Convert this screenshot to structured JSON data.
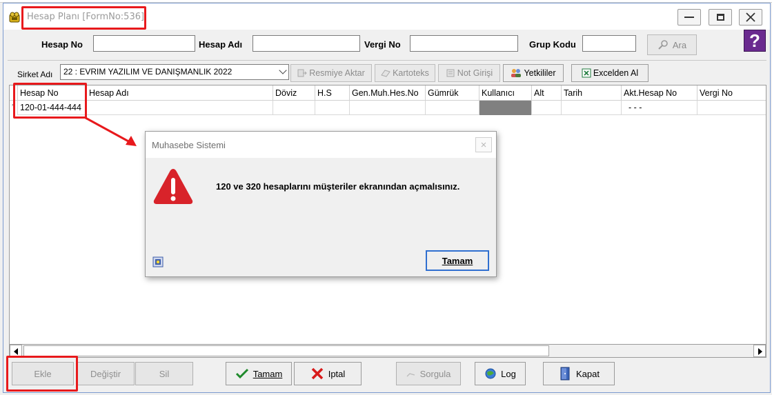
{
  "window": {
    "title": "Hesap Planı [FormNo:536]"
  },
  "search": {
    "hesap_no_label": "Hesap No",
    "hesap_no_value": "",
    "hesap_adi_label": "Hesap Adı",
    "hesap_adi_value": "",
    "vergi_no_label": "Vergi No",
    "vergi_no_value": "",
    "grup_kodu_label": "Grup Kodu",
    "grup_kodu_value": "",
    "ara_label": "Ara",
    "help_label": "?"
  },
  "toolbar": {
    "sirket_label": "Sirket Adı",
    "sirket_value": "22 : EVRIM YAZILIM  VE DANIŞMANLIK 2022",
    "resmiye_aktar": "Resmiye Aktar",
    "kartoteks": "Kartoteks",
    "not_girisi": "Not Girişi",
    "yetkililer": "Yetkililer",
    "excelden_al": "Excelden Al"
  },
  "grid": {
    "columns": [
      "Hesap No",
      "Hesap Adı",
      "Döviz",
      "H.S",
      "Gen.Muh.Hes.No",
      "Gümrük",
      "Kullanıcı",
      "Alt",
      "Tarih",
      "Akt.Hesap No",
      "Vergi No"
    ],
    "row_marker": "*",
    "row": [
      "120-01-444-444",
      "",
      "",
      "",
      "",
      "",
      "",
      "",
      "",
      "- - -",
      ""
    ]
  },
  "bottom": {
    "ekle": "Ekle",
    "degistir": "Değiştir",
    "sil": "Sil",
    "tamam": "Tamam",
    "iptal": "Iptal",
    "sorgula": "Sorgula",
    "log": "Log",
    "kapat": "Kapat"
  },
  "dialog": {
    "title": "Muhasebe Sistemi",
    "message": "120 ve 320 hesaplarını müşteriler ekranından açmalısınız.",
    "ok_label": "Tamam"
  },
  "colors": {
    "annotation_red": "#e8191c",
    "warning_red": "#d8232a",
    "focus_blue": "#2f6fd0"
  }
}
